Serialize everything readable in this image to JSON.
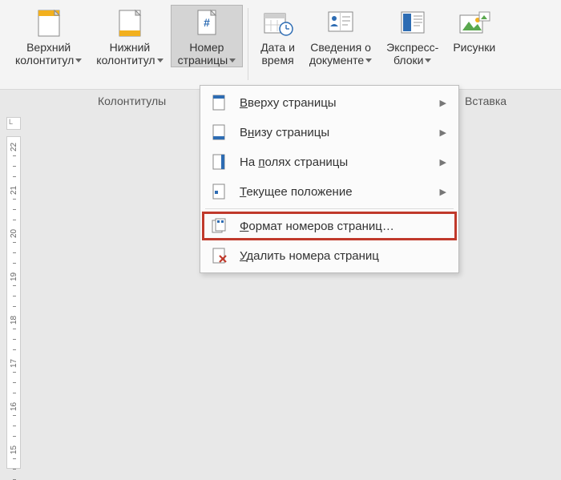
{
  "ribbon": {
    "headerFooterGroup": "Колонтитулы",
    "insertGroup": "Вставка",
    "buttons": {
      "headerTop": {
        "line1": "Верхний",
        "line2": "колонтитул"
      },
      "headerBottom": {
        "line1": "Нижний",
        "line2": "колонтитул"
      },
      "pageNumber": {
        "line1": "Номер",
        "line2": "страницы"
      },
      "dateTime": {
        "line1": "Дата и",
        "line2": "время"
      },
      "docInfo": {
        "line1": "Сведения о",
        "line2": "документе"
      },
      "quickParts": {
        "line1": "Экспресс-",
        "line2": "блоки"
      },
      "pictures": {
        "line1": "Рисунки",
        "line2": ""
      }
    }
  },
  "menu": {
    "items": [
      {
        "label": "Вверху страницы",
        "accel": "В",
        "submenu": true,
        "icon": "page-top"
      },
      {
        "label": "Внизу страницы",
        "accel": "н",
        "submenu": true,
        "icon": "page-bottom"
      },
      {
        "label": "На полях страницы",
        "accel": "п",
        "submenu": true,
        "icon": "page-margins"
      },
      {
        "label": "Текущее положение",
        "accel": "Т",
        "submenu": true,
        "icon": "page-current"
      },
      {
        "label": "Формат номеров страниц…",
        "accel": "Ф",
        "submenu": false,
        "icon": "page-format",
        "highlight": true
      },
      {
        "label": "Удалить номера страниц",
        "accel": "У",
        "submenu": false,
        "icon": "page-delete"
      }
    ]
  },
  "ruler": {
    "marks": [
      "22",
      "21",
      "20",
      "19",
      "18",
      "17",
      "16",
      "15"
    ]
  }
}
